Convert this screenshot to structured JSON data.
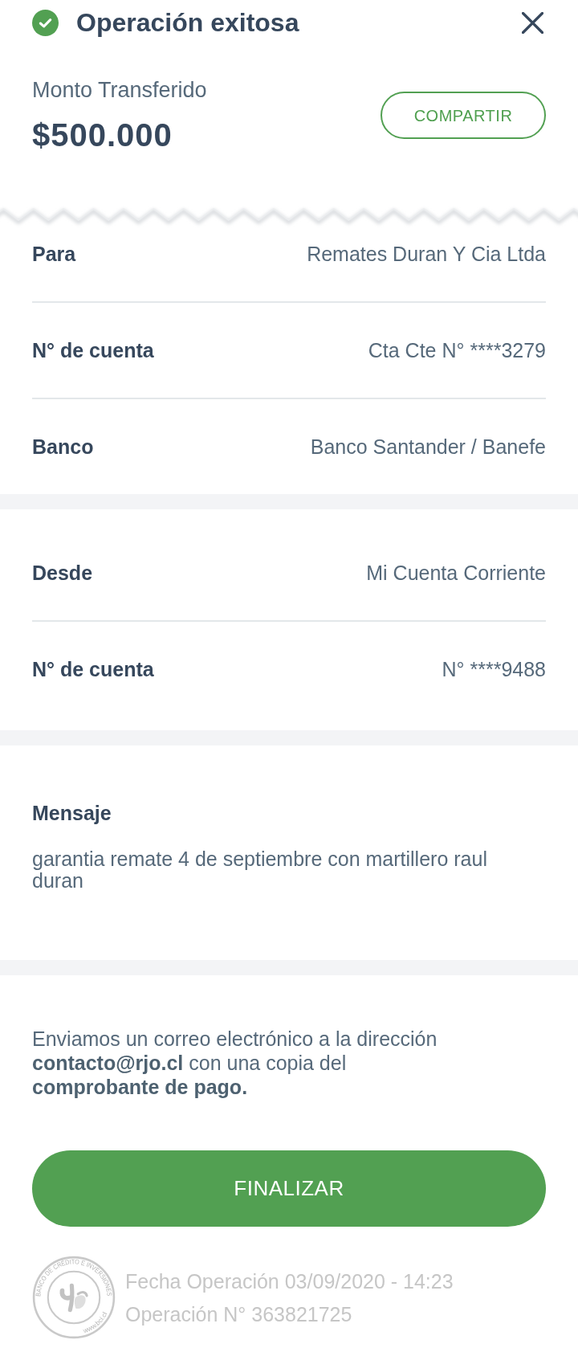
{
  "header": {
    "title": "Operación exitosa"
  },
  "amount": {
    "label": "Monto Transferido",
    "value": "$500.000"
  },
  "share_button": "COMPARTIR",
  "recipient": {
    "rows": [
      {
        "label": "Para",
        "value": "Remates Duran Y Cia Ltda"
      },
      {
        "label": "N° de cuenta",
        "value": "Cta Cte N° ****3279"
      },
      {
        "label": "Banco",
        "value": "Banco Santander / Banefe"
      }
    ]
  },
  "origin": {
    "rows": [
      {
        "label": "Desde",
        "value": "Mi Cuenta Corriente"
      },
      {
        "label": "N° de cuenta",
        "value": "N° ****9488"
      }
    ]
  },
  "message": {
    "label": "Mensaje",
    "text": "garantia remate 4 de septiembre con martillero raul duran"
  },
  "email_notice": "Enviamos un correo electrónico a la dirección\n**contacto@rjo.cl** con una copia del\n**comprobante de pago.**",
  "finish_button": "FINALIZAR",
  "footer": {
    "seal": {
      "ring_text": "BANCO DE CRÉDITO E INVERSIONES",
      "url": "www.bci.cl"
    },
    "lines": [
      "Fecha Operación 03/09/2020 - 14:23",
      "Operación N° 363821725"
    ]
  }
}
